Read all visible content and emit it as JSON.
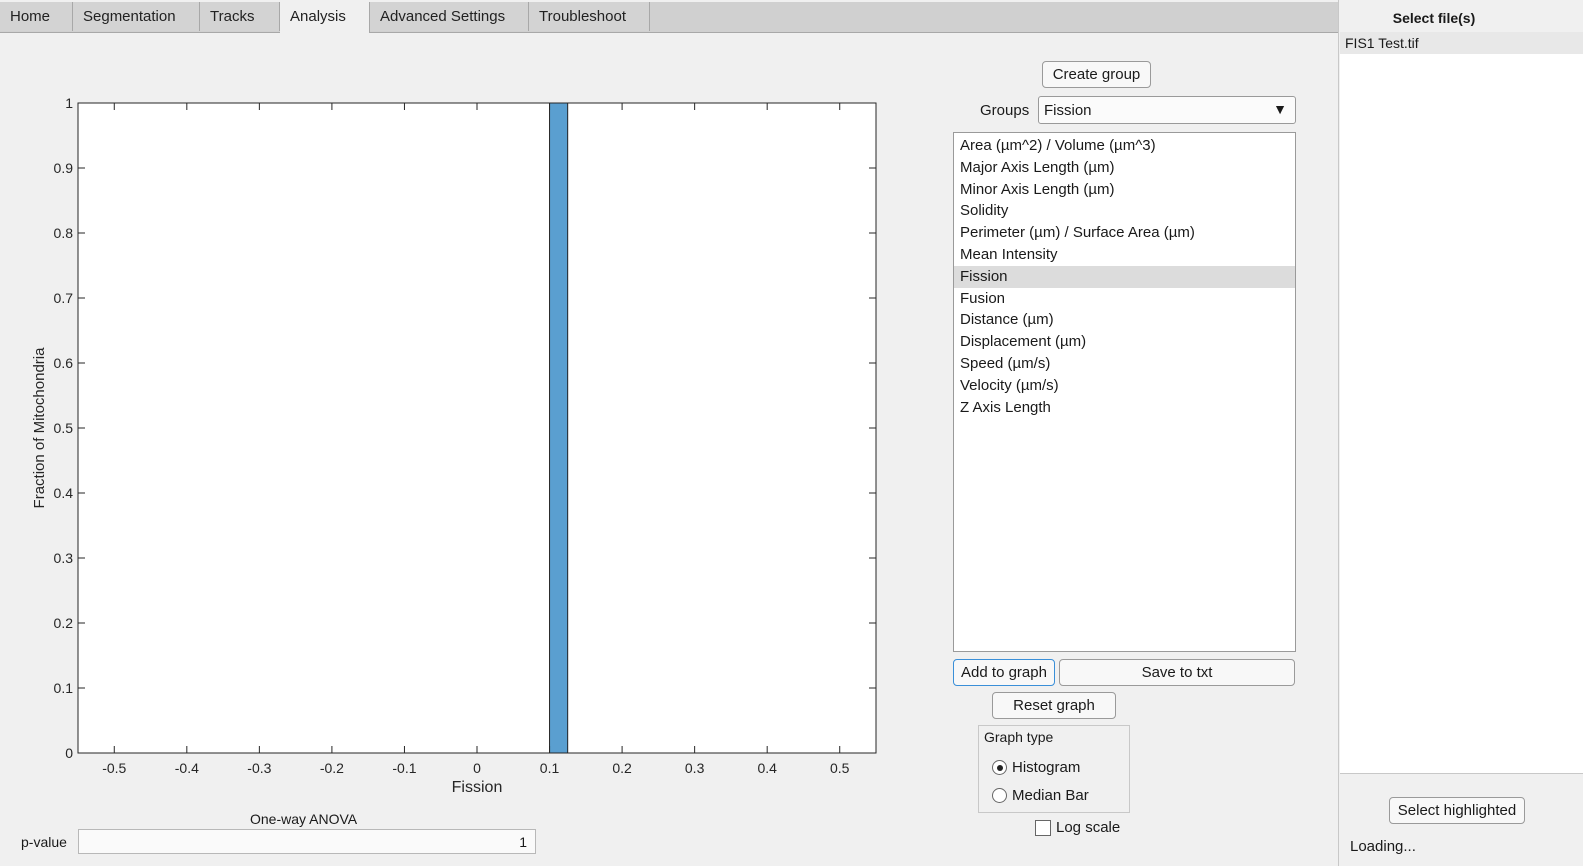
{
  "tabs": [
    {
      "label": "Home"
    },
    {
      "label": "Segmentation"
    },
    {
      "label": "Tracks"
    },
    {
      "label": "Analysis",
      "active": true
    },
    {
      "label": "Advanced Settings"
    },
    {
      "label": "Troubleshoot"
    }
  ],
  "chart_data": {
    "type": "bar",
    "xlabel": "Fission",
    "ylabel": "Fraction of Mitochondria",
    "xlim": [
      -0.55,
      0.55
    ],
    "ylim": [
      0,
      1
    ],
    "xticks": [
      "-0.5",
      "-0.4",
      "-0.3",
      "-0.2",
      "-0.1",
      "0",
      "0.1",
      "0.2",
      "0.3",
      "0.4",
      "0.5"
    ],
    "yticks": [
      "0",
      "0.1",
      "0.2",
      "0.3",
      "0.4",
      "0.5",
      "0.6",
      "0.7",
      "0.8",
      "0.9",
      "1"
    ],
    "bars": [
      {
        "x0": 0.1,
        "x1": 0.125,
        "value": 1
      }
    ],
    "bar_color": "#5a9fd0",
    "grid": false
  },
  "controls": {
    "create_group": "Create group",
    "groups_label": "Groups",
    "groups_selected": "Fission",
    "dropdown_arrow": "▼",
    "measures": [
      "Area (µm^2) / Volume (µm^3)",
      "Major Axis Length (µm)",
      "Minor Axis Length (µm)",
      "Solidity",
      "Perimeter (µm) / Surface Area (µm)",
      "Mean Intensity",
      "Fission",
      "Fusion",
      "Distance (µm)",
      "Displacement (µm)",
      "Speed (µm/s)",
      "Velocity (µm/s)",
      "Z Axis Length"
    ],
    "selected_measure_index": 6,
    "add_to_graph": "Add to graph",
    "save_to_txt": "Save to txt",
    "reset_graph": "Reset graph",
    "graph_type_title": "Graph type",
    "graph_types": [
      "Histogram",
      "Median Bar"
    ],
    "graph_type_selected": "Histogram",
    "log_scale": "Log scale",
    "log_scale_checked": false
  },
  "stats": {
    "title": "One-way ANOVA",
    "pvalue_label": "p-value",
    "pvalue": "1"
  },
  "files": {
    "header": "Select file(s)",
    "items": [
      "FIS1 Test.tif"
    ],
    "select_highlighted": "Select highlighted",
    "status": "Loading..."
  }
}
